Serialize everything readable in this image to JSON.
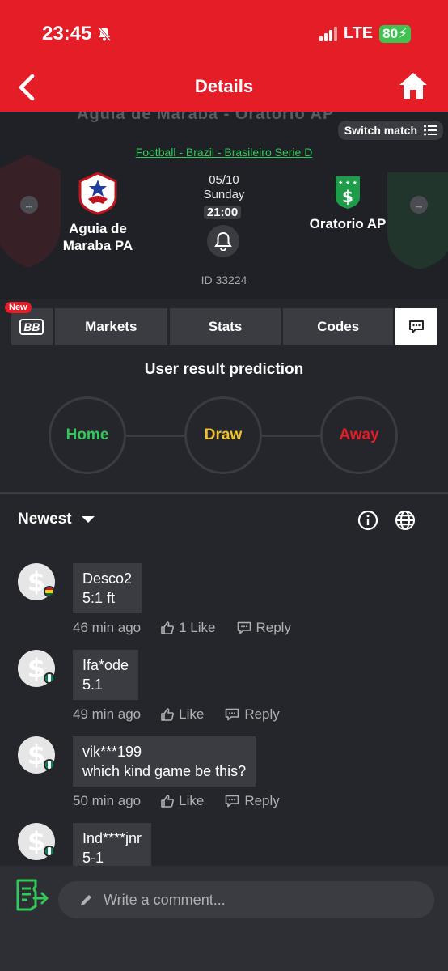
{
  "status": {
    "time": "23:45",
    "network": "LTE",
    "battery": "80"
  },
  "nav": {
    "title": "Details"
  },
  "match": {
    "ghost_title": "Aguia de Maraba - Oratorio AP",
    "switch_label": "Switch match",
    "league": "Football - Brazil - Brasileiro Serie D",
    "home_team": "Aguia de Maraba PA",
    "away_team": "Oratorio AP",
    "date": "05/10",
    "day": "Sunday",
    "kickoff": "21:00",
    "id_text": "ID 33224"
  },
  "tabs": {
    "new_badge": "New",
    "bb": "BB",
    "markets": "Markets",
    "stats": "Stats",
    "codes": "Codes"
  },
  "prediction": {
    "title": "User result prediction",
    "home": "Home",
    "draw": "Draw",
    "away": "Away"
  },
  "sort": {
    "label": "Newest"
  },
  "comments": [
    {
      "user": "Desco2",
      "text": "5:1 ft",
      "time": "46 min ago",
      "like": "1 Like",
      "reply": "Reply",
      "flag": "ghana"
    },
    {
      "user": "Ifa*ode",
      "text": "5.1",
      "time": "49 min ago",
      "like": "Like",
      "reply": "Reply",
      "flag": "nigeria"
    },
    {
      "user": "vik***199",
      "text": "which kind game be this?",
      "time": "50 min ago",
      "like": "Like",
      "reply": "Reply",
      "flag": "nigeria"
    },
    {
      "user": "Ind****jnr",
      "text": "5-1",
      "time": "",
      "like": "",
      "reply": "",
      "flag": "nigeria"
    }
  ],
  "composer": {
    "placeholder": "Write a comment..."
  },
  "colors": {
    "brand_red": "#e41d27",
    "accent_green": "#34c759",
    "draw_yellow": "#f2c12e",
    "panel": "#3a3c42"
  }
}
